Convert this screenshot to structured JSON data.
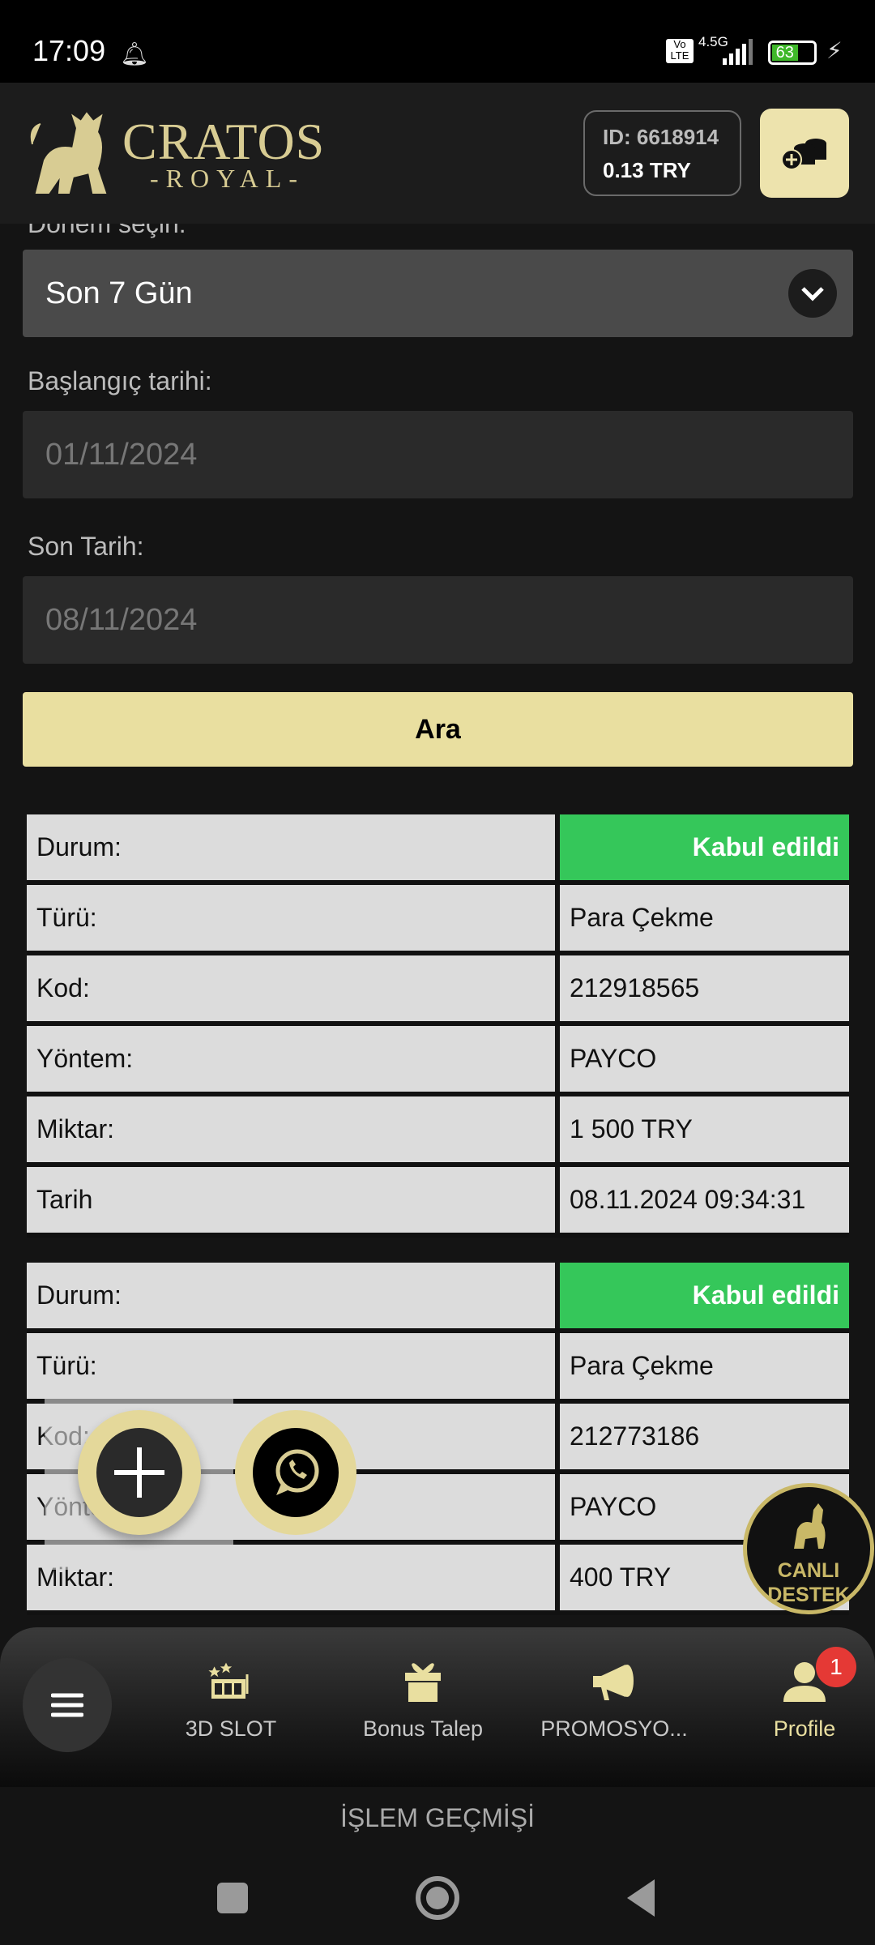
{
  "status_bar": {
    "time": "17:09",
    "network": "4.5G",
    "volte": "Vo LTE",
    "battery": "63"
  },
  "header": {
    "brand": "CRATOS",
    "brand_sub": "-ROYAL-",
    "user_id": "ID: 6618914",
    "balance": "0.13 TRY"
  },
  "filters": {
    "period_label": "Dönem seçin:",
    "period_value": "Son 7 Gün",
    "start_label": "Başlangıç tarihi:",
    "start_value": "01/11/2024",
    "end_label": "Son Tarih:",
    "end_value": "08/11/2024",
    "search_button": "Ara"
  },
  "transactions": [
    {
      "rows": [
        [
          "Durum:",
          "Kabul edildi"
        ],
        [
          "Türü:",
          "Para Çekme"
        ],
        [
          "Kod:",
          "212918565"
        ],
        [
          "Yöntem:",
          "PAYCO"
        ],
        [
          "Miktar:",
          "1 500 TRY"
        ],
        [
          "Tarih",
          "08.11.2024 09:34:31"
        ]
      ]
    },
    {
      "rows": [
        [
          "Durum:",
          "Kabul edildi"
        ],
        [
          "Türü:",
          "Para Çekme"
        ],
        [
          "Kod:",
          "212773186"
        ],
        [
          "Yöntem:",
          "PAYCO"
        ],
        [
          "Miktar:",
          "400 TRY"
        ]
      ]
    }
  ],
  "live_support": {
    "line1": "CANLI",
    "line2": "DESTEK"
  },
  "bottom_nav": {
    "items": [
      {
        "label": "3D SLOT"
      },
      {
        "label": "Bonus Talep"
      },
      {
        "label": "PROMOSYO..."
      },
      {
        "label": "Profile",
        "badge": "1"
      }
    ]
  },
  "page_title": "İŞLEM GEÇMİŞİ",
  "colors": {
    "accent": "#e9dfa0",
    "success": "#35c75a",
    "badge": "#e53935"
  }
}
